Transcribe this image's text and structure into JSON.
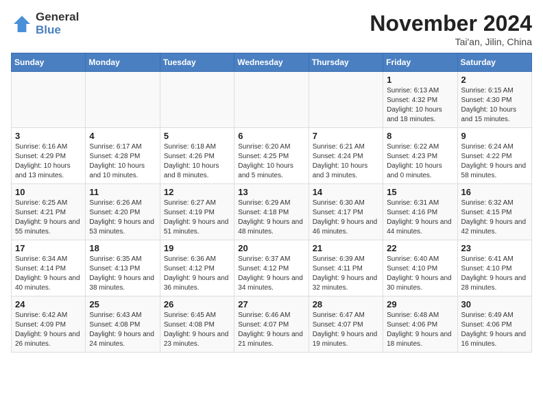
{
  "logo": {
    "general": "General",
    "blue": "Blue"
  },
  "header": {
    "month": "November 2024",
    "location": "Tai'an, Jilin, China"
  },
  "weekdays": [
    "Sunday",
    "Monday",
    "Tuesday",
    "Wednesday",
    "Thursday",
    "Friday",
    "Saturday"
  ],
  "weeks": [
    [
      {
        "day": "",
        "sunrise": "",
        "sunset": "",
        "daylight": ""
      },
      {
        "day": "",
        "sunrise": "",
        "sunset": "",
        "daylight": ""
      },
      {
        "day": "",
        "sunrise": "",
        "sunset": "",
        "daylight": ""
      },
      {
        "day": "",
        "sunrise": "",
        "sunset": "",
        "daylight": ""
      },
      {
        "day": "",
        "sunrise": "",
        "sunset": "",
        "daylight": ""
      },
      {
        "day": "1",
        "sunrise": "Sunrise: 6:13 AM",
        "sunset": "Sunset: 4:32 PM",
        "daylight": "Daylight: 10 hours and 18 minutes."
      },
      {
        "day": "2",
        "sunrise": "Sunrise: 6:15 AM",
        "sunset": "Sunset: 4:30 PM",
        "daylight": "Daylight: 10 hours and 15 minutes."
      }
    ],
    [
      {
        "day": "3",
        "sunrise": "Sunrise: 6:16 AM",
        "sunset": "Sunset: 4:29 PM",
        "daylight": "Daylight: 10 hours and 13 minutes."
      },
      {
        "day": "4",
        "sunrise": "Sunrise: 6:17 AM",
        "sunset": "Sunset: 4:28 PM",
        "daylight": "Daylight: 10 hours and 10 minutes."
      },
      {
        "day": "5",
        "sunrise": "Sunrise: 6:18 AM",
        "sunset": "Sunset: 4:26 PM",
        "daylight": "Daylight: 10 hours and 8 minutes."
      },
      {
        "day": "6",
        "sunrise": "Sunrise: 6:20 AM",
        "sunset": "Sunset: 4:25 PM",
        "daylight": "Daylight: 10 hours and 5 minutes."
      },
      {
        "day": "7",
        "sunrise": "Sunrise: 6:21 AM",
        "sunset": "Sunset: 4:24 PM",
        "daylight": "Daylight: 10 hours and 3 minutes."
      },
      {
        "day": "8",
        "sunrise": "Sunrise: 6:22 AM",
        "sunset": "Sunset: 4:23 PM",
        "daylight": "Daylight: 10 hours and 0 minutes."
      },
      {
        "day": "9",
        "sunrise": "Sunrise: 6:24 AM",
        "sunset": "Sunset: 4:22 PM",
        "daylight": "Daylight: 9 hours and 58 minutes."
      }
    ],
    [
      {
        "day": "10",
        "sunrise": "Sunrise: 6:25 AM",
        "sunset": "Sunset: 4:21 PM",
        "daylight": "Daylight: 9 hours and 55 minutes."
      },
      {
        "day": "11",
        "sunrise": "Sunrise: 6:26 AM",
        "sunset": "Sunset: 4:20 PM",
        "daylight": "Daylight: 9 hours and 53 minutes."
      },
      {
        "day": "12",
        "sunrise": "Sunrise: 6:27 AM",
        "sunset": "Sunset: 4:19 PM",
        "daylight": "Daylight: 9 hours and 51 minutes."
      },
      {
        "day": "13",
        "sunrise": "Sunrise: 6:29 AM",
        "sunset": "Sunset: 4:18 PM",
        "daylight": "Daylight: 9 hours and 48 minutes."
      },
      {
        "day": "14",
        "sunrise": "Sunrise: 6:30 AM",
        "sunset": "Sunset: 4:17 PM",
        "daylight": "Daylight: 9 hours and 46 minutes."
      },
      {
        "day": "15",
        "sunrise": "Sunrise: 6:31 AM",
        "sunset": "Sunset: 4:16 PM",
        "daylight": "Daylight: 9 hours and 44 minutes."
      },
      {
        "day": "16",
        "sunrise": "Sunrise: 6:32 AM",
        "sunset": "Sunset: 4:15 PM",
        "daylight": "Daylight: 9 hours and 42 minutes."
      }
    ],
    [
      {
        "day": "17",
        "sunrise": "Sunrise: 6:34 AM",
        "sunset": "Sunset: 4:14 PM",
        "daylight": "Daylight: 9 hours and 40 minutes."
      },
      {
        "day": "18",
        "sunrise": "Sunrise: 6:35 AM",
        "sunset": "Sunset: 4:13 PM",
        "daylight": "Daylight: 9 hours and 38 minutes."
      },
      {
        "day": "19",
        "sunrise": "Sunrise: 6:36 AM",
        "sunset": "Sunset: 4:12 PM",
        "daylight": "Daylight: 9 hours and 36 minutes."
      },
      {
        "day": "20",
        "sunrise": "Sunrise: 6:37 AM",
        "sunset": "Sunset: 4:12 PM",
        "daylight": "Daylight: 9 hours and 34 minutes."
      },
      {
        "day": "21",
        "sunrise": "Sunrise: 6:39 AM",
        "sunset": "Sunset: 4:11 PM",
        "daylight": "Daylight: 9 hours and 32 minutes."
      },
      {
        "day": "22",
        "sunrise": "Sunrise: 6:40 AM",
        "sunset": "Sunset: 4:10 PM",
        "daylight": "Daylight: 9 hours and 30 minutes."
      },
      {
        "day": "23",
        "sunrise": "Sunrise: 6:41 AM",
        "sunset": "Sunset: 4:10 PM",
        "daylight": "Daylight: 9 hours and 28 minutes."
      }
    ],
    [
      {
        "day": "24",
        "sunrise": "Sunrise: 6:42 AM",
        "sunset": "Sunset: 4:09 PM",
        "daylight": "Daylight: 9 hours and 26 minutes."
      },
      {
        "day": "25",
        "sunrise": "Sunrise: 6:43 AM",
        "sunset": "Sunset: 4:08 PM",
        "daylight": "Daylight: 9 hours and 24 minutes."
      },
      {
        "day": "26",
        "sunrise": "Sunrise: 6:45 AM",
        "sunset": "Sunset: 4:08 PM",
        "daylight": "Daylight: 9 hours and 23 minutes."
      },
      {
        "day": "27",
        "sunrise": "Sunrise: 6:46 AM",
        "sunset": "Sunset: 4:07 PM",
        "daylight": "Daylight: 9 hours and 21 minutes."
      },
      {
        "day": "28",
        "sunrise": "Sunrise: 6:47 AM",
        "sunset": "Sunset: 4:07 PM",
        "daylight": "Daylight: 9 hours and 19 minutes."
      },
      {
        "day": "29",
        "sunrise": "Sunrise: 6:48 AM",
        "sunset": "Sunset: 4:06 PM",
        "daylight": "Daylight: 9 hours and 18 minutes."
      },
      {
        "day": "30",
        "sunrise": "Sunrise: 6:49 AM",
        "sunset": "Sunset: 4:06 PM",
        "daylight": "Daylight: 9 hours and 16 minutes."
      }
    ]
  ]
}
